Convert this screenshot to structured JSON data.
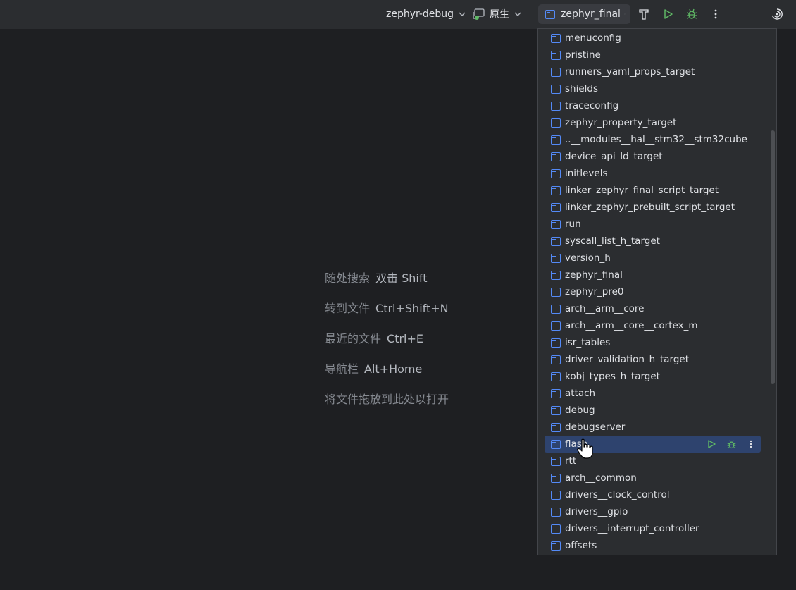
{
  "toolbar": {
    "project_selector": "zephyr-debug",
    "toolchain_selector": "原生",
    "run_config_selector": "zephyr_final",
    "build_icon": "hammer-icon",
    "run_icon": "run-icon",
    "debug_icon": "debug-icon",
    "more_icon": "more-vertical-icon",
    "ai_icon": "ai-assistant-icon"
  },
  "editor_hints": [
    {
      "label": "随处搜索",
      "key": "双击 Shift"
    },
    {
      "label": "转到文件",
      "key": "Ctrl+Shift+N"
    },
    {
      "label": "最近的文件",
      "key": "Ctrl+E"
    },
    {
      "label": "导航栏",
      "key": "Alt+Home"
    },
    {
      "label": "将文件拖放到此处以打开",
      "key": ""
    }
  ],
  "run_config_popup": {
    "items": [
      "menuconfig",
      "pristine",
      "runners_yaml_props_target",
      "shields",
      "traceconfig",
      "zephyr_property_target",
      "..__modules__hal__stm32__stm32cube",
      "device_api_ld_target",
      "initlevels",
      "linker_zephyr_final_script_target",
      "linker_zephyr_prebuilt_script_target",
      "run",
      "syscall_list_h_target",
      "version_h",
      "zephyr_final",
      "zephyr_pre0",
      "arch__arm__core",
      "arch__arm__core__cortex_m",
      "isr_tables",
      "driver_validation_h_target",
      "kobj_types_h_target",
      "attach",
      "debug",
      "debugserver",
      "flash",
      "rtt",
      "arch__common",
      "drivers__clock_control",
      "drivers__gpio",
      "drivers__interrupt_controller",
      "offsets"
    ],
    "selected_item": "flash"
  },
  "colors": {
    "accent": "#548af7",
    "run_green": "#5fb865",
    "selection": "#2e436e"
  }
}
